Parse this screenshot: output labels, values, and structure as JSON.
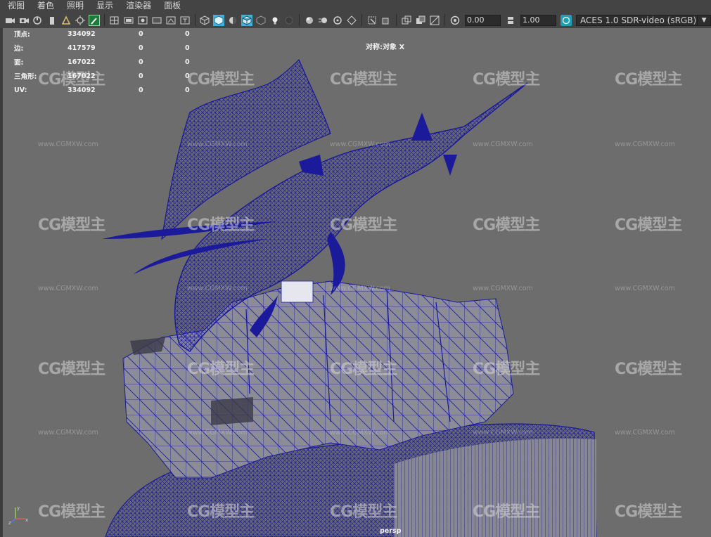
{
  "menu": [
    "视图",
    "着色",
    "照明",
    "显示",
    "渲染器",
    "面板"
  ],
  "toolbar": {
    "exposure_value": "0.00",
    "gamma_value": "1.00",
    "color_space": "ACES 1.0 SDR-video (sRGB)"
  },
  "hud": {
    "rows": [
      {
        "label": "顶点:",
        "value": "334092",
        "c1": "0",
        "c2": "0"
      },
      {
        "label": "边:",
        "value": "417579",
        "c1": "0",
        "c2": "0"
      },
      {
        "label": "面:",
        "value": "167022",
        "c1": "0",
        "c2": "0"
      },
      {
        "label": "三角形:",
        "value": "167022",
        "c1": "0",
        "c2": "0"
      },
      {
        "label": "UV:",
        "value": "334092",
        "c1": "0",
        "c2": "0"
      }
    ],
    "symmetry": "对称:对象 X",
    "camera": "persp"
  },
  "watermark": {
    "logo": "CG模型主",
    "url": "www.CGMXW.com"
  },
  "axis": {
    "y": "y",
    "x": "x",
    "z": "z"
  },
  "colors": {
    "wire": "#1a1a9a",
    "viewport_bg": "#6d6d6d",
    "toolbar_bg": "#444444",
    "active_icon": "#3fb4d6"
  }
}
